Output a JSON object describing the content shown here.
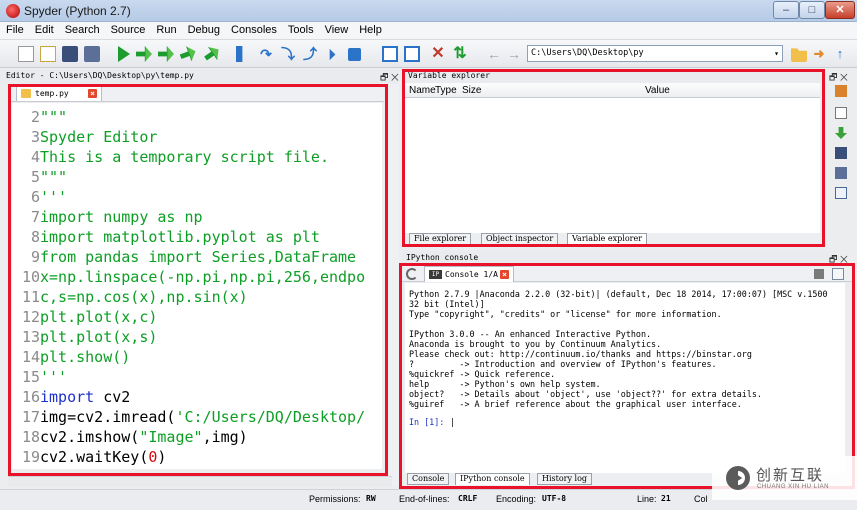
{
  "window": {
    "title": "Spyder (Python 2.7)",
    "min": "–",
    "max": "□",
    "close": "✕"
  },
  "menu": [
    "File",
    "Edit",
    "Search",
    "Source",
    "Run",
    "Debug",
    "Consoles",
    "Tools",
    "View",
    "Help"
  ],
  "toolbar": {
    "path": "C:\\Users\\DQ\\Desktop\\py",
    "back": "←",
    "forward": "→",
    "dropdown": "▾",
    "icons": [
      "new-file-icon",
      "open-file-icon",
      "save-icon",
      "save-all-icon",
      "run-icon",
      "run-cell-icon",
      "run-cell-advance-icon",
      "run-selection-icon",
      "debug-icon",
      "continue-icon",
      "step-icon",
      "step-into-icon",
      "step-return-icon",
      "stop-debug-icon",
      "maximize-pane-icon",
      "fullscreen-icon",
      "preferences-icon",
      "python-path-icon"
    ]
  },
  "editor": {
    "title": "Editor - C:\\Users\\DQ\\Desktop\\py\\temp.py",
    "dock": "🗗 ✕",
    "tab": "temp.py",
    "lines": [
      {
        "n": "2",
        "parts": [
          {
            "t": "\"\"\"",
            "c": "green"
          }
        ]
      },
      {
        "n": "3",
        "parts": [
          {
            "t": "Spyder Editor",
            "c": "green"
          }
        ]
      },
      {
        "n": "4",
        "parts": [
          {
            "t": "This is a temporary script file.",
            "c": "green"
          }
        ]
      },
      {
        "n": "5",
        "parts": [
          {
            "t": "\"\"\"",
            "c": "green"
          }
        ]
      },
      {
        "n": "6",
        "parts": [
          {
            "t": "'''",
            "c": "green"
          }
        ]
      },
      {
        "n": "7",
        "parts": [
          {
            "t": "import numpy as np",
            "c": "green"
          }
        ]
      },
      {
        "n": "8",
        "parts": [
          {
            "t": "import matplotlib.pyplot as plt",
            "c": "green"
          }
        ]
      },
      {
        "n": "9",
        "parts": [
          {
            "t": "from pandas import Series,DataFrame",
            "c": "green"
          }
        ]
      },
      {
        "n": "10",
        "parts": [
          {
            "t": "x=np.linspace(-np.pi,np.pi,256,endpo",
            "c": "green"
          }
        ]
      },
      {
        "n": "11",
        "parts": [
          {
            "t": "c,s=np.cos(x),np.sin(x)",
            "c": "green"
          }
        ]
      },
      {
        "n": "12",
        "parts": [
          {
            "t": "plt.plot(x,c)",
            "c": "green"
          }
        ]
      },
      {
        "n": "13",
        "parts": [
          {
            "t": "plt.plot(x,s)",
            "c": "green"
          }
        ]
      },
      {
        "n": "14",
        "parts": [
          {
            "t": "plt.show()",
            "c": "green"
          }
        ]
      },
      {
        "n": "15",
        "parts": [
          {
            "t": "'''",
            "c": "green"
          }
        ]
      },
      {
        "n": "16",
        "parts": [
          {
            "t": "import",
            "c": "blue"
          },
          {
            "t": " cv2",
            "c": "black"
          }
        ]
      },
      {
        "n": "17",
        "parts": [
          {
            "t": "img=cv2.imread(",
            "c": "black"
          },
          {
            "t": "'C:/Users/DQ/Desktop/",
            "c": "green"
          }
        ]
      },
      {
        "n": "18",
        "parts": [
          {
            "t": "cv2.imshow(",
            "c": "black"
          },
          {
            "t": "\"Image\"",
            "c": "green"
          },
          {
            "t": ",img)",
            "c": "black"
          }
        ]
      },
      {
        "n": "19",
        "parts": [
          {
            "t": "cv2.waitKey(",
            "c": "black"
          },
          {
            "t": "0",
            "c": "red"
          },
          {
            "t": ")",
            "c": "black"
          }
        ]
      }
    ]
  },
  "variable_explorer": {
    "title": "Variable explorer",
    "dock": "🗗 ✕",
    "columns": [
      "Name",
      "Type",
      "Size",
      "Value"
    ],
    "tabs": [
      "File explorer",
      "Object inspector",
      "Variable explorer"
    ],
    "active_tab": "Variable explorer"
  },
  "ipython": {
    "title": "IPython console",
    "dock": "🗗 ✕",
    "tab": "Console 1/A",
    "tab_icon": "IP",
    "output": [
      "Python 2.7.9 |Anaconda 2.2.0 (32-bit)| (default, Dec 18 2014, 17:00:07) [MSC v.1500",
      "32 bit (Intel)]",
      "Type \"copyright\", \"credits\" or \"license\" for more information.",
      "",
      "IPython 3.0.0 -- An enhanced Interactive Python.",
      "Anaconda is brought to you by Continuum Analytics.",
      "Please check out: http://continuum.io/thanks and https://binstar.org",
      "?         -> Introduction and overview of IPython's features.",
      "%quickref -> Quick reference.",
      "help      -> Python's own help system.",
      "object?   -> Details about 'object', use 'object??' for extra details.",
      "%guiref   -> A brief reference about the graphical user interface."
    ],
    "prompt": "In [1]: ",
    "tabs": [
      "Console",
      "IPython console",
      "History log"
    ],
    "active_tab": "IPython console"
  },
  "status": {
    "permissions_label": "Permissions:",
    "permissions": "RW",
    "eol_label": "End-of-lines:",
    "eol": "CRLF",
    "encoding_label": "Encoding:",
    "encoding": "UTF-8",
    "line_label": "Line:",
    "line": "21",
    "col_label": "Col"
  },
  "watermark": {
    "cn": "创新互联",
    "en": "CHUANG XIN HU LIAN"
  },
  "colors": {
    "highlight": "#e8132b",
    "string": "#0d9f25",
    "keyword": "#1d31c9",
    "number": "#d00a0a"
  }
}
